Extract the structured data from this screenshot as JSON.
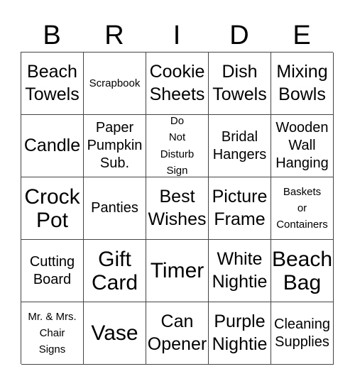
{
  "title_letters": [
    "B",
    "R",
    "I",
    "D",
    "E"
  ],
  "cells": [
    {
      "text": "Beach\nTowels",
      "size": "l"
    },
    {
      "text": "Scrapbook",
      "size": "s"
    },
    {
      "text": "Cookie\nSheets",
      "size": "l"
    },
    {
      "text": "Dish\nTowels",
      "size": "l"
    },
    {
      "text": "Mixing\nBowls",
      "size": "l"
    },
    {
      "text": "Candle",
      "size": "l"
    },
    {
      "text": "Paper\nPumpkin\nSub.",
      "size": "m"
    },
    {
      "text": "Do\nNot\nDisturb\nSign",
      "size": "s"
    },
    {
      "text": "Bridal\nHangers",
      "size": "m"
    },
    {
      "text": "Wooden\nWall\nHanging",
      "size": "m"
    },
    {
      "text": "Crock\nPot",
      "size": "xl"
    },
    {
      "text": "Panties",
      "size": "m"
    },
    {
      "text": "Best\nWishes",
      "size": "l"
    },
    {
      "text": "Picture\nFrame",
      "size": "l"
    },
    {
      "text": "Baskets\nor\nContainers",
      "size": "s"
    },
    {
      "text": "Cutting\nBoard",
      "size": "m"
    },
    {
      "text": "Gift\nCard",
      "size": "xl"
    },
    {
      "text": "Timer",
      "size": "xl"
    },
    {
      "text": "White\nNightie",
      "size": "l"
    },
    {
      "text": "Beach\nBag",
      "size": "xl"
    },
    {
      "text": "Mr. & Mrs.\nChair\nSigns",
      "size": "s"
    },
    {
      "text": "Vase",
      "size": "xl"
    },
    {
      "text": "Can\nOpener",
      "size": "l"
    },
    {
      "text": "Purple\nNightie",
      "size": "l"
    },
    {
      "text": "Cleaning\nSupplies",
      "size": "m"
    }
  ]
}
